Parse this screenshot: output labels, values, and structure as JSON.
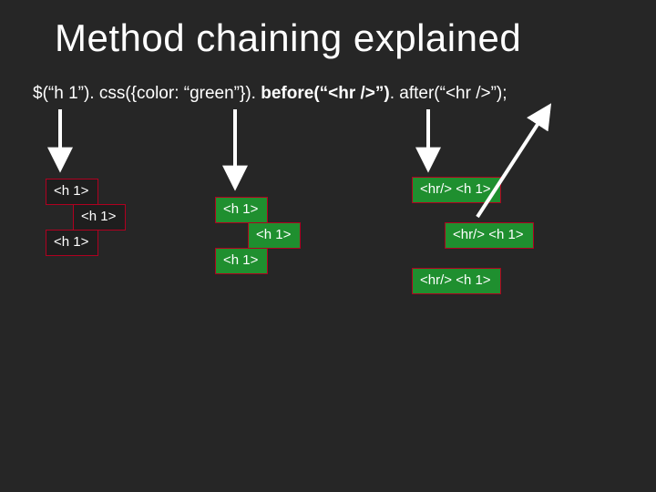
{
  "title": "Method chaining explained",
  "code": {
    "seg1": "$(“h 1”). css({color: “green”}). ",
    "bold": "before(“<hr />”)",
    "seg2": ". after(“<hr />”);"
  },
  "boxes": {
    "a1": "<h 1>",
    "a2": "<h 1>",
    "a3": "<h 1>",
    "b1": "<h 1>",
    "b2": "<h 1>",
    "b3": "<h 1>",
    "c1": "<hr/>\n<h 1>",
    "c2": "<hr/>\n<h 1>",
    "c3": "<hr/>\n<h 1>"
  }
}
